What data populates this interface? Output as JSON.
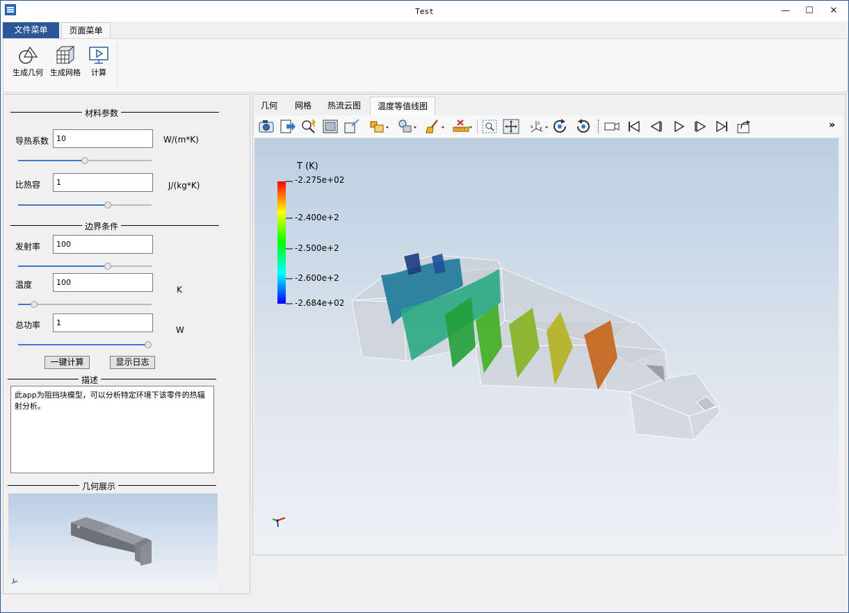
{
  "window": {
    "title": "Test",
    "min": "—",
    "max": "☐",
    "close": "✕"
  },
  "top_tabs": [
    "文件菜单",
    "页面菜单"
  ],
  "ribbon": {
    "buttons": [
      "生成几何",
      "生成网格",
      "计算"
    ]
  },
  "left": {
    "material_section": "材料参数",
    "conductivity_label": "导热系数",
    "conductivity_value": "10",
    "conductivity_unit": "W/(m*K)",
    "conductivity_slider": 0.5,
    "heatcap_label": "比热容",
    "heatcap_value": "1",
    "heatcap_unit": "J/(kg*K)",
    "heatcap_slider": 0.68,
    "boundary_section": "边界条件",
    "emissivity_label": "发射率",
    "emissivity_value": "100",
    "emissivity_slider": 0.68,
    "temp_label": "温度",
    "temp_value": "100",
    "temp_unit": "K",
    "temp_slider": 0.1,
    "power_label": "总功率",
    "power_value": "1",
    "power_unit": "W",
    "power_slider": 1.0,
    "calc_button": "一键计算",
    "log_button": "显示日志",
    "desc_section": "描述",
    "desc_text": "此app为阻挡块模型，可以分析特定环境下该零件的热辐射分析。",
    "preview_section": "几何展示"
  },
  "view_tabs": [
    "几何",
    "网格",
    "热流云图",
    "温度等值线图"
  ],
  "active_view_tab": 3,
  "toolbar_overflow": "»",
  "colorbar": {
    "title": "T (K)",
    "labels": [
      "-2.275e+02",
      "-2.400e+2",
      "-2.500e+2",
      "-2.600e+2",
      "-2.684e+02"
    ],
    "colors": [
      "#ff0000",
      "#ffff00",
      "#00ff00",
      "#00ffff",
      "#0000ff"
    ]
  }
}
